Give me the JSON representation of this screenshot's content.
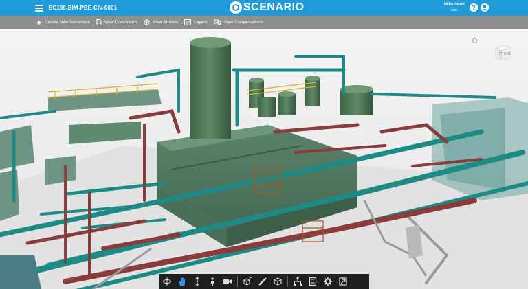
{
  "header": {
    "doc_title": "SC198-BIM-PBE-CIV-0001",
    "logo_text": "SCENARIO",
    "user_name": "Mike Scott",
    "user_org": "NBC",
    "help_label": "?"
  },
  "toolbar": {
    "items": [
      {
        "label": "Create New Document",
        "icon": "plus-icon"
      },
      {
        "label": "View Documents",
        "icon": "document-icon"
      },
      {
        "label": "View Models",
        "icon": "cube-icon"
      },
      {
        "label": "Layers",
        "icon": "layers-icon"
      },
      {
        "label": "View Conversations",
        "icon": "chat-icon"
      }
    ]
  },
  "viewcube": {
    "face_label": "FRONT"
  },
  "bottom_toolbar": {
    "groups": [
      [
        "orbit-icon",
        "pan-hand-icon",
        "zoom-icon",
        "walk-person-icon",
        "camera-icon"
      ],
      [
        "measure-cube-icon",
        "ruler-icon",
        "section-box-icon"
      ],
      [
        "model-tree-icon",
        "properties-icon",
        "settings-gear-icon",
        "fullscreen-icon"
      ]
    ],
    "active": "pan-hand-icon"
  },
  "colors": {
    "accent": "#1e9bd8",
    "toolbar_bg": "#8f8f8f",
    "pipe_teal": "#1d8a86",
    "pipe_red": "#8a3b3b",
    "equipment_green": "#4f7a5a"
  }
}
